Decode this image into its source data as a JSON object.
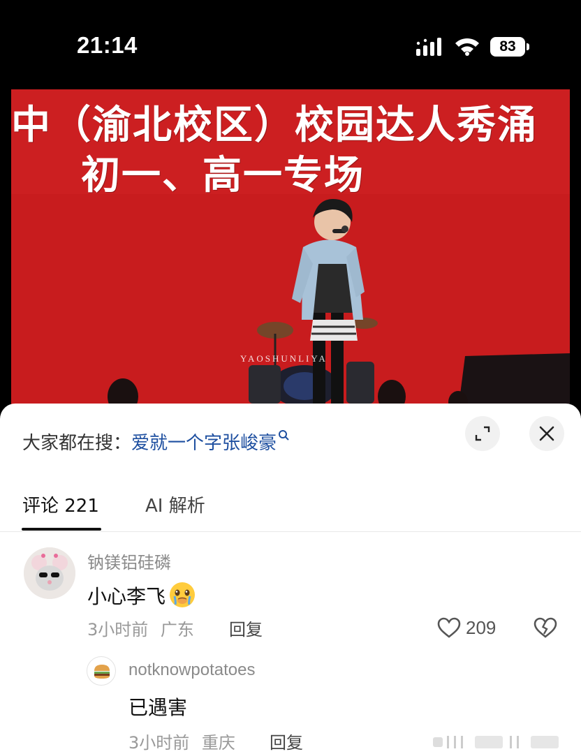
{
  "status_bar": {
    "time": "21:14",
    "battery": "83"
  },
  "video": {
    "banner_line1": "中（渝北校区）校园达人秀涌",
    "banner_line2": "初一、高一专场",
    "watermark": "YAOSHUNLIYA",
    "primary_color": "#c81c1e"
  },
  "sheet": {
    "search_prefix": "大家都在搜：",
    "search_keyword": "爱就一个字张峻豪",
    "tabs": [
      {
        "label": "评论 221",
        "active": true
      },
      {
        "label": "AI 解析",
        "active": false
      }
    ],
    "comments": [
      {
        "username": "钠镁铝硅磷",
        "text": "小心李飞",
        "emoji": "crying-face",
        "time": "3小时前",
        "location": "广东",
        "reply_label": "回复",
        "likes": "209"
      },
      {
        "username": "notknowpotatoes",
        "text": "已遇害",
        "time": "3小时前",
        "location": "重庆",
        "reply_label": "回复"
      }
    ]
  },
  "accent_color": "#1e4fa0"
}
